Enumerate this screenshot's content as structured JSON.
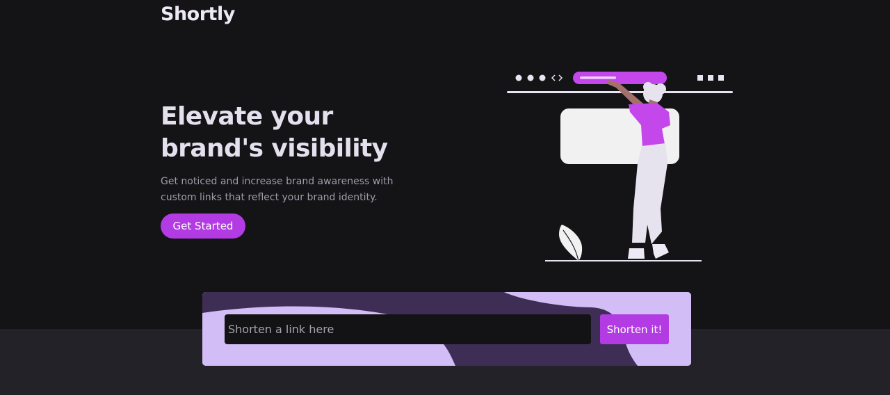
{
  "brand": {
    "logo_text": "Shortly"
  },
  "hero": {
    "headline": "Elevate your brand's visibility",
    "subtext": "Get noticed and increase brand awareness with custom links that reflect your brand identity.",
    "cta_label": "Get Started"
  },
  "shortener": {
    "input_placeholder": "Shorten a link here",
    "input_value": "",
    "button_label": "Shorten it!"
  },
  "colors": {
    "accent": "#b33be3",
    "hero_bg": "#141315",
    "page_bg": "#232228",
    "card_light": "#d2bdf6",
    "card_dark": "#3e2e55"
  },
  "illustration": {
    "icon": "person-reaching-browser-illustration"
  }
}
